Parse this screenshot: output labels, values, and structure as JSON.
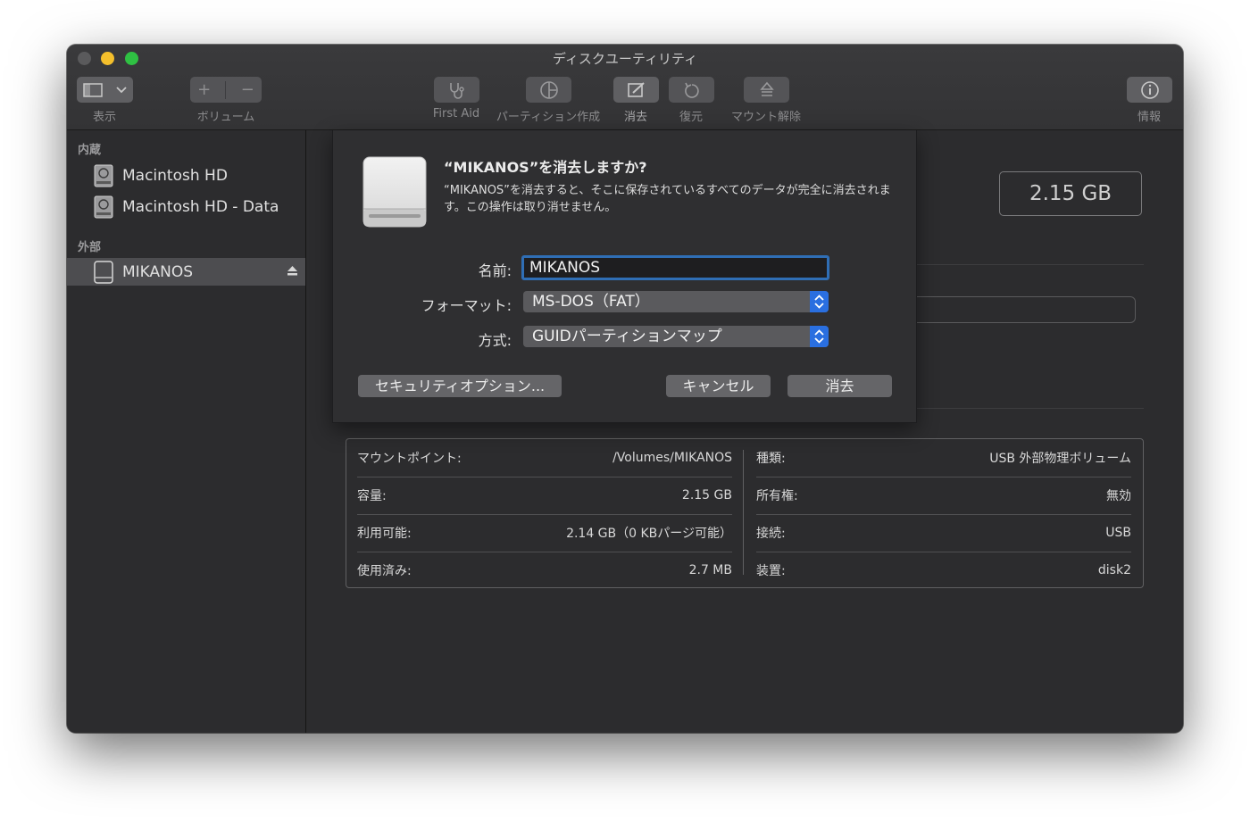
{
  "window": {
    "title": "ディスクユーティリティ"
  },
  "toolbar": {
    "view_label": "表示",
    "volume_label": "ボリューム",
    "first_aid_label": "First Aid",
    "partition_label": "パーティション作成",
    "erase_label": "消去",
    "restore_label": "復元",
    "unmount_label": "マウント解除",
    "info_label": "情報"
  },
  "sidebar": {
    "internal_header": "内蔵",
    "external_header": "外部",
    "internal_items": [
      {
        "label": "Macintosh HD"
      },
      {
        "label": "Macintosh HD - Data"
      }
    ],
    "external_items": [
      {
        "label": "MIKANOS",
        "selected": true
      }
    ]
  },
  "main": {
    "capacity": "2.15 GB",
    "info": {
      "mount_point_label": "マウントポイント:",
      "mount_point_value": "/Volumes/MIKANOS",
      "capacity_label": "容量:",
      "capacity_value": "2.15 GB",
      "available_label": "利用可能:",
      "available_value": "2.14 GB（0 KBパージ可能）",
      "used_label": "使用済み:",
      "used_value": "2.7 MB",
      "type_label": "種類:",
      "type_value": "USB 外部物理ボリューム",
      "owners_label": "所有権:",
      "owners_value": "無効",
      "connection_label": "接続:",
      "connection_value": "USB",
      "device_label": "装置:",
      "device_value": "disk2"
    }
  },
  "dialog": {
    "title": "“MIKANOS”を消去しますか?",
    "message": "“MIKANOS”を消去すると、そこに保存されているすべてのデータが完全に消去されます。この操作は取り消せません。",
    "name_label": "名前:",
    "name_value": "MIKANOS",
    "format_label": "フォーマット:",
    "format_value": "MS-DOS（FAT）",
    "scheme_label": "方式:",
    "scheme_value": "GUIDパーティションマップ",
    "security_button": "セキュリティオプション...",
    "cancel_button": "キャンセル",
    "erase_button": "消去"
  },
  "colors": {
    "accent": "#2a6fe0",
    "window_bg": "#2c2c2e",
    "selected_row": "#4d4d50",
    "traffic_yellow": "#f4bf2c",
    "traffic_green": "#2fc143"
  }
}
